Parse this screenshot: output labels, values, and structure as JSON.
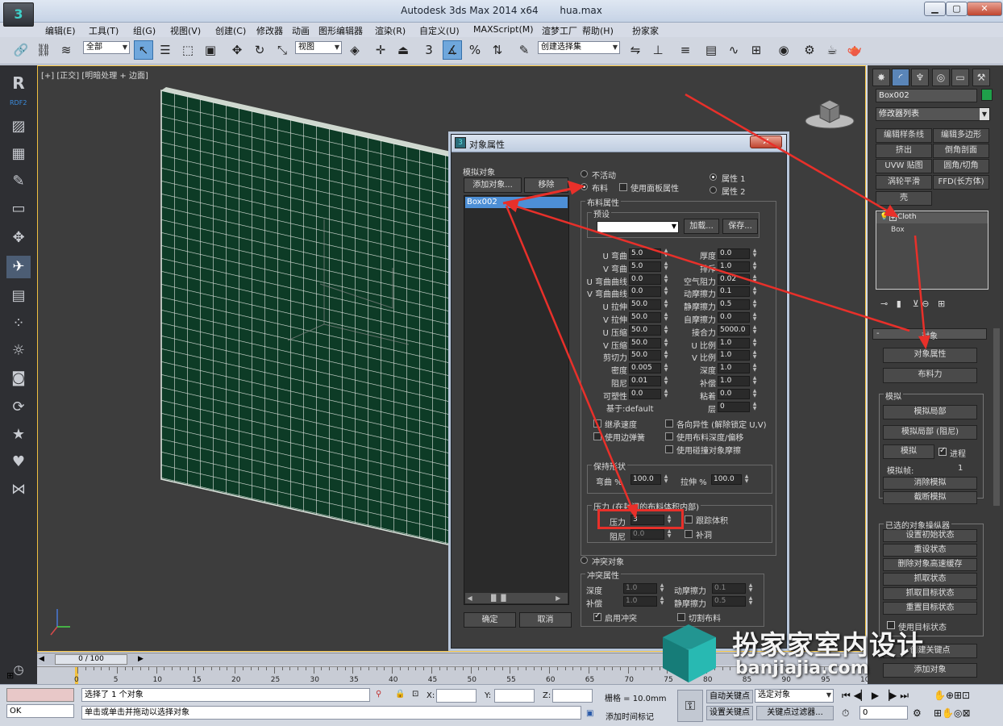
{
  "window": {
    "title": "Autodesk 3ds Max  2014 x64",
    "file": "hua.max",
    "min": "▁",
    "max": "▢",
    "close": "✕"
  },
  "menu": [
    "编辑(E)",
    "工具(T)",
    "组(G)",
    "视图(V)",
    "创建(C)",
    "修改器",
    "动画",
    "图形编辑器",
    "渲染(R)",
    "自定义(U)",
    "MAXScript(M)",
    "渲梦工厂",
    "帮助(H)",
    "扮家家"
  ],
  "toolbar": {
    "filter": "全部",
    "view": "视图",
    "selection_set": "创建选择集",
    "snap_num": "3",
    "percent": "%"
  },
  "left_sidebar": {
    "logo": "R",
    "logo_sub": "RDF2"
  },
  "viewport": {
    "label": "[+] [正交] [明暗处理 + 边面]"
  },
  "timeline": {
    "frame": "0 / 100",
    "ticks": [
      "0",
      "5",
      "10",
      "15",
      "20",
      "25",
      "30",
      "35",
      "40",
      "45",
      "50",
      "55",
      "60",
      "65",
      "70",
      "75",
      "80",
      "85",
      "90",
      "95",
      "100"
    ]
  },
  "status": {
    "message": "选择了 1 个对象",
    "prompt": "单击或单击并拖动以选择对象",
    "ok": "OK",
    "x_label": "X:",
    "y_label": "Y:",
    "z_label": "Z:",
    "grid": "栅格 = 10.0mm",
    "auto_key": "自动关键点",
    "set_key": "设置关键点",
    "selected_obj": "选定对象",
    "key_filter": "关键点过滤器...",
    "add_time_tag": "添加时间标记",
    "frame_field": "0"
  },
  "command_panel": {
    "object_name": "Box002",
    "object_color": "#1fa04a",
    "modifier_list": "修改器列表",
    "mod_buttons": [
      "编辑样条线",
      "编辑多边形",
      "挤出",
      "倒角剖面",
      "UVW 贴图",
      "圆角/切角",
      "涡轮平滑",
      "FFD(长方体)",
      "壳"
    ],
    "stack": [
      "Cloth",
      "Box"
    ],
    "rollout_object": "对象",
    "btn_obj_props": "对象属性",
    "btn_cloth_force": "布料力",
    "sim_label": "模拟",
    "btn_sim_local": "模拟局部",
    "btn_sim_local_damp": "模拟局部 (阻尼)",
    "btn_sim": "模拟",
    "progress_label": "进程",
    "sim_frame_label": "模拟帧:",
    "sim_frame_val": "1",
    "btn_clear_sim": "消除模拟",
    "btn_cut_sim": "截断模拟",
    "selected_manip": "已选的对象操纵器",
    "btn_set_init": "设置初始状态",
    "btn_reset": "重设状态",
    "btn_delete_cache": "删除对象高速缓存",
    "btn_grab": "抓取状态",
    "btn_grab_target": "抓取目标状态",
    "btn_reset_target": "重置目标状态",
    "use_target": "使用目标状态",
    "btn_create_key": "创建关键点",
    "btn_add_obj": "添加对象"
  },
  "dialog": {
    "title": "对象属性",
    "sim_objects": "模拟对象",
    "add_object": "添加对象...",
    "remove": "移除",
    "list": [
      "Box002"
    ],
    "ok": "确定",
    "cancel": "取消",
    "radio_inactive": "不活动",
    "radio_cloth": "布料",
    "use_panel_props": "使用面板属性",
    "prop1": "属性 1",
    "prop2": "属性 2",
    "cloth_props": "布料属性",
    "preset": "预设",
    "load": "加载...",
    "save": "保存...",
    "left_params": [
      {
        "label": "U 弯曲",
        "value": "5.0"
      },
      {
        "label": "V 弯曲",
        "value": "5.0"
      },
      {
        "label": "U 弯曲曲线",
        "value": "0.0"
      },
      {
        "label": "V 弯曲曲线",
        "value": "0.0"
      },
      {
        "label": "U 拉伸",
        "value": "50.0"
      },
      {
        "label": "V 拉伸",
        "value": "50.0"
      },
      {
        "label": "U 压缩",
        "value": "50.0"
      },
      {
        "label": "V 压缩",
        "value": "50.0"
      },
      {
        "label": "剪切力",
        "value": "50.0"
      },
      {
        "label": "密度",
        "value": "0.005"
      },
      {
        "label": "阻尼",
        "value": "0.01"
      },
      {
        "label": "可塑性",
        "value": "0.0"
      }
    ],
    "right_params": [
      {
        "label": "厚度",
        "value": "0.0"
      },
      {
        "label": "排斥",
        "value": "1.0"
      },
      {
        "label": "空气阻力",
        "value": "0.02"
      },
      {
        "label": "动摩擦力",
        "value": "0.1"
      },
      {
        "label": "静摩擦力",
        "value": "0.5"
      },
      {
        "label": "自摩擦力",
        "value": "0.0"
      },
      {
        "label": "接合力",
        "value": "5000.0"
      },
      {
        "label": "U 比例",
        "value": "1.0"
      },
      {
        "label": "V 比例",
        "value": "1.0"
      },
      {
        "label": "深度",
        "value": "1.0"
      },
      {
        "label": "补偿",
        "value": "1.0"
      },
      {
        "label": "粘着",
        "value": "0.0"
      },
      {
        "label": "层",
        "value": "0"
      }
    ],
    "based_on": "基于:default",
    "inherit_velocity": "继承速度",
    "use_edge_springs": "使用边弹簧",
    "anisotropic": "各向异性 (解除锁定 U,V)",
    "use_cloth_depth": "使用布料深度/偏移",
    "use_collide_friction": "使用碰撞对象摩擦",
    "keep_shape": "保持形状",
    "bend_pct_label": "弯曲 %",
    "bend_pct": "100.0",
    "stretch_pct_label": "拉伸 %",
    "stretch_pct": "100.0",
    "pressure_group": "压力 (在封闭的布料体积内部)",
    "pressure_label": "压力",
    "pressure": "3",
    "track_volume": "跟踪体积",
    "damping_label": "阻尼",
    "damping": "0.0",
    "patch": "补洞",
    "collision_obj": "冲突对象",
    "collision_props": "冲突属性",
    "depth_label": "深度",
    "depth": "1.0",
    "offset_label": "补偿",
    "offset": "1.0",
    "dyn_fric_label": "动摩擦力",
    "dyn_fric": "0.1",
    "stat_fric_label": "静摩擦力",
    "stat_fric": "0.5",
    "enable_collision": "启用冲突",
    "cut_cloth": "切割布料"
  },
  "watermark": {
    "cn": "扮家家室内设计",
    "url": "banjiajia.com"
  }
}
